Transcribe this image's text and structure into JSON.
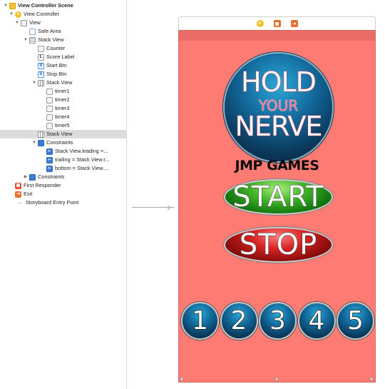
{
  "outline": {
    "items": [
      {
        "label": "View Controller Scene",
        "icon": "scene-icon",
        "disclosure": "open",
        "bold": true
      },
      {
        "label": "View Controller",
        "icon": "view-controller-icon",
        "disclosure": "open"
      },
      {
        "label": "View",
        "icon": "view-icon",
        "disclosure": "open"
      },
      {
        "label": "Safe Area",
        "icon": "safe-area-icon",
        "disclosure": ""
      },
      {
        "label": "Stack View",
        "icon": "stack-view-icon",
        "disclosure": "open"
      },
      {
        "label": "Counter",
        "icon": "image-view-icon",
        "disclosure": ""
      },
      {
        "label": "Score Label",
        "icon": "label-icon",
        "disclosure": ""
      },
      {
        "label": "Start Btn",
        "icon": "button-icon",
        "disclosure": ""
      },
      {
        "label": "Stop Btn",
        "icon": "button-icon",
        "disclosure": ""
      },
      {
        "label": "Stack View",
        "icon": "horizontal-stack-view-icon",
        "disclosure": "open"
      },
      {
        "label": "timer1",
        "icon": "image-view-icon",
        "disclosure": ""
      },
      {
        "label": "timer2",
        "icon": "image-view-icon",
        "disclosure": ""
      },
      {
        "label": "timer3",
        "icon": "image-view-icon",
        "disclosure": ""
      },
      {
        "label": "timer4",
        "icon": "image-view-icon",
        "disclosure": ""
      },
      {
        "label": "timer5",
        "icon": "image-view-icon",
        "disclosure": ""
      },
      {
        "label": "Stack View",
        "icon": "horizontal-stack-view-icon",
        "disclosure": "",
        "selected": true
      },
      {
        "label": "Constraints",
        "icon": "constraints-icon",
        "disclosure": "open"
      },
      {
        "label": "Stack View.leading =...",
        "icon": "constraint-icon",
        "disclosure": ""
      },
      {
        "label": "trailing = Stack View.t...",
        "icon": "constraint-icon",
        "disclosure": ""
      },
      {
        "label": "bottom = Stack View....",
        "icon": "constraint-icon",
        "disclosure": ""
      },
      {
        "label": "Constraints",
        "icon": "constraints-icon",
        "disclosure": "closed"
      },
      {
        "label": "First Responder",
        "icon": "first-responder-icon",
        "disclosure": ""
      },
      {
        "label": "Exit",
        "icon": "exit-icon",
        "disclosure": ""
      },
      {
        "label": "Storyboard Entry Point",
        "icon": "entry-arrow-icon",
        "disclosure": ""
      }
    ]
  },
  "scene": {
    "dock_icons": [
      "view-controller-icon",
      "first-responder-icon",
      "exit-icon"
    ],
    "background_color": "#fe7b74",
    "logo_lines": [
      "HOLD",
      "YOUR",
      "NERVE"
    ],
    "company_label": "JMP GAMES",
    "start_label": "START",
    "stop_label": "STOP",
    "timers": [
      "1",
      "2",
      "3",
      "4",
      "5"
    ]
  },
  "colors": {
    "selection": "#dcdcdc",
    "start_green": "#44b52a",
    "stop_red": "#d62222",
    "timer_blue": "#12689a"
  }
}
